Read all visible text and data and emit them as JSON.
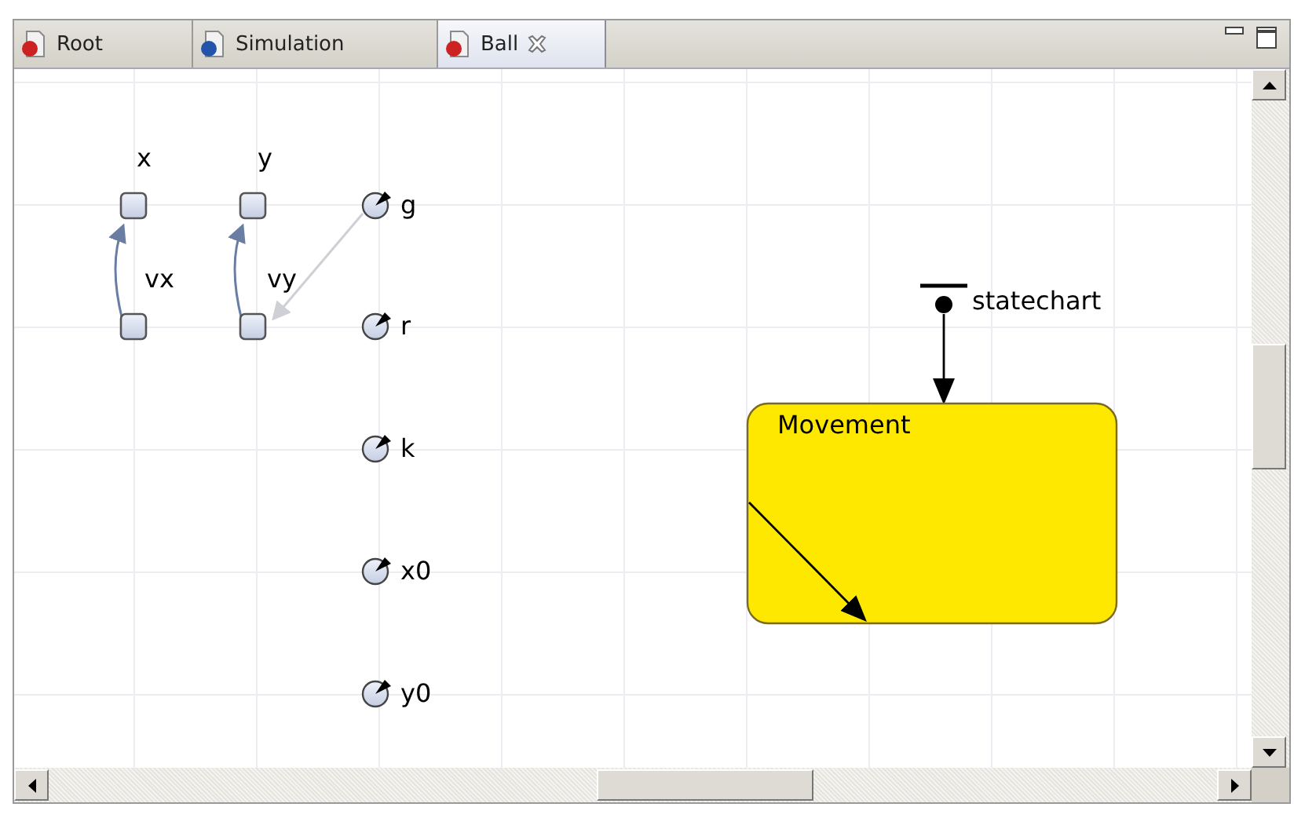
{
  "tabs": [
    {
      "label": "Root",
      "kind": "agent",
      "selected": false,
      "closable": false
    },
    {
      "label": "Simulation",
      "kind": "experiment",
      "selected": false,
      "closable": false
    },
    {
      "label": "Ball",
      "kind": "agent",
      "selected": true,
      "closable": true
    }
  ],
  "stocks": [
    {
      "name": "x"
    },
    {
      "name": "y"
    },
    {
      "name": "vx"
    },
    {
      "name": "vy"
    }
  ],
  "parameters": [
    {
      "name": "g"
    },
    {
      "name": "r"
    },
    {
      "name": "k"
    },
    {
      "name": "x0"
    },
    {
      "name": "y0"
    }
  ],
  "statechart": {
    "name": "statechart",
    "states": [
      {
        "name": "Movement"
      }
    ]
  }
}
